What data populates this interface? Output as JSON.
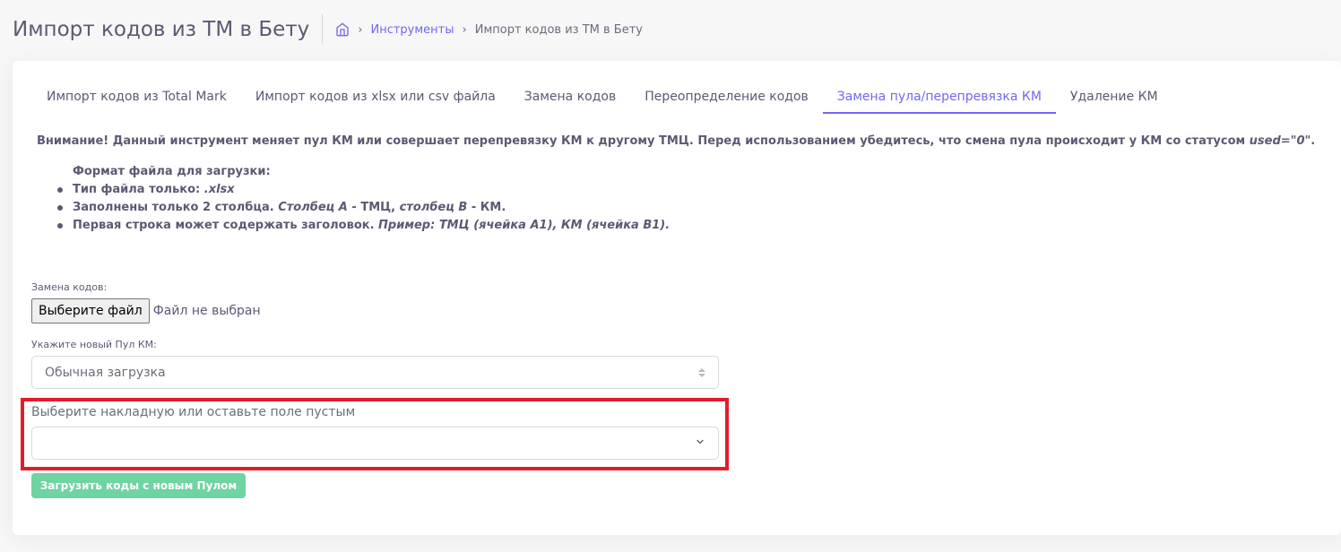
{
  "header": {
    "title": "Импорт кодов из ТМ в Бету",
    "breadcrumb": {
      "link": "Инструменты",
      "current": "Импорт кодов из ТМ в Бету"
    }
  },
  "tabs": [
    {
      "label": "Импорт кодов из Total Mark"
    },
    {
      "label": "Импорт кодов из xlsx или csv файла"
    },
    {
      "label": "Замена кодов"
    },
    {
      "label": "Переопределение кодов"
    },
    {
      "label": "Замена пула/перепревязка КМ"
    },
    {
      "label": "Удаление КМ"
    }
  ],
  "warning": {
    "text": "Внимание! Данный инструмент меняет пул КМ или совершает перепревязку КМ к другому ТМЦ. Перед использованием убедитесь, что смена пула происходит у КМ со статусом ",
    "code": "used=\"0\"",
    "end": "."
  },
  "format": {
    "title": "Формат файла для загрузки:",
    "item1_prefix": "Тип файла только: ",
    "item1_ext": ".xlsx",
    "item2_prefix": "Заполнены только 2 столбца. ",
    "item2_colA": "Столбец A",
    "item2_mid": " - ТМЦ, ",
    "item2_colB": "столбец B",
    "item2_end": " - КМ.",
    "item3_prefix": "Первая строка может содержать заголовок. ",
    "item3_example": "Пример: ТМЦ (ячейка A1), КМ (ячейка B1)."
  },
  "form": {
    "codes_label": "Замена кодов:",
    "file_button": "Выберите файл",
    "file_status": "Файл не выбран",
    "pool_label": "Укажите новый Пул КМ:",
    "pool_value": "Обычная загрузка",
    "invoice_label": "Выберите накладную или оставьте поле пустым",
    "invoice_value": "",
    "submit": "Загрузить коды с новым Пулом"
  },
  "colors": {
    "accent": "#7367f0",
    "success": "#6fd3a2",
    "highlight": "#e11d2a"
  }
}
